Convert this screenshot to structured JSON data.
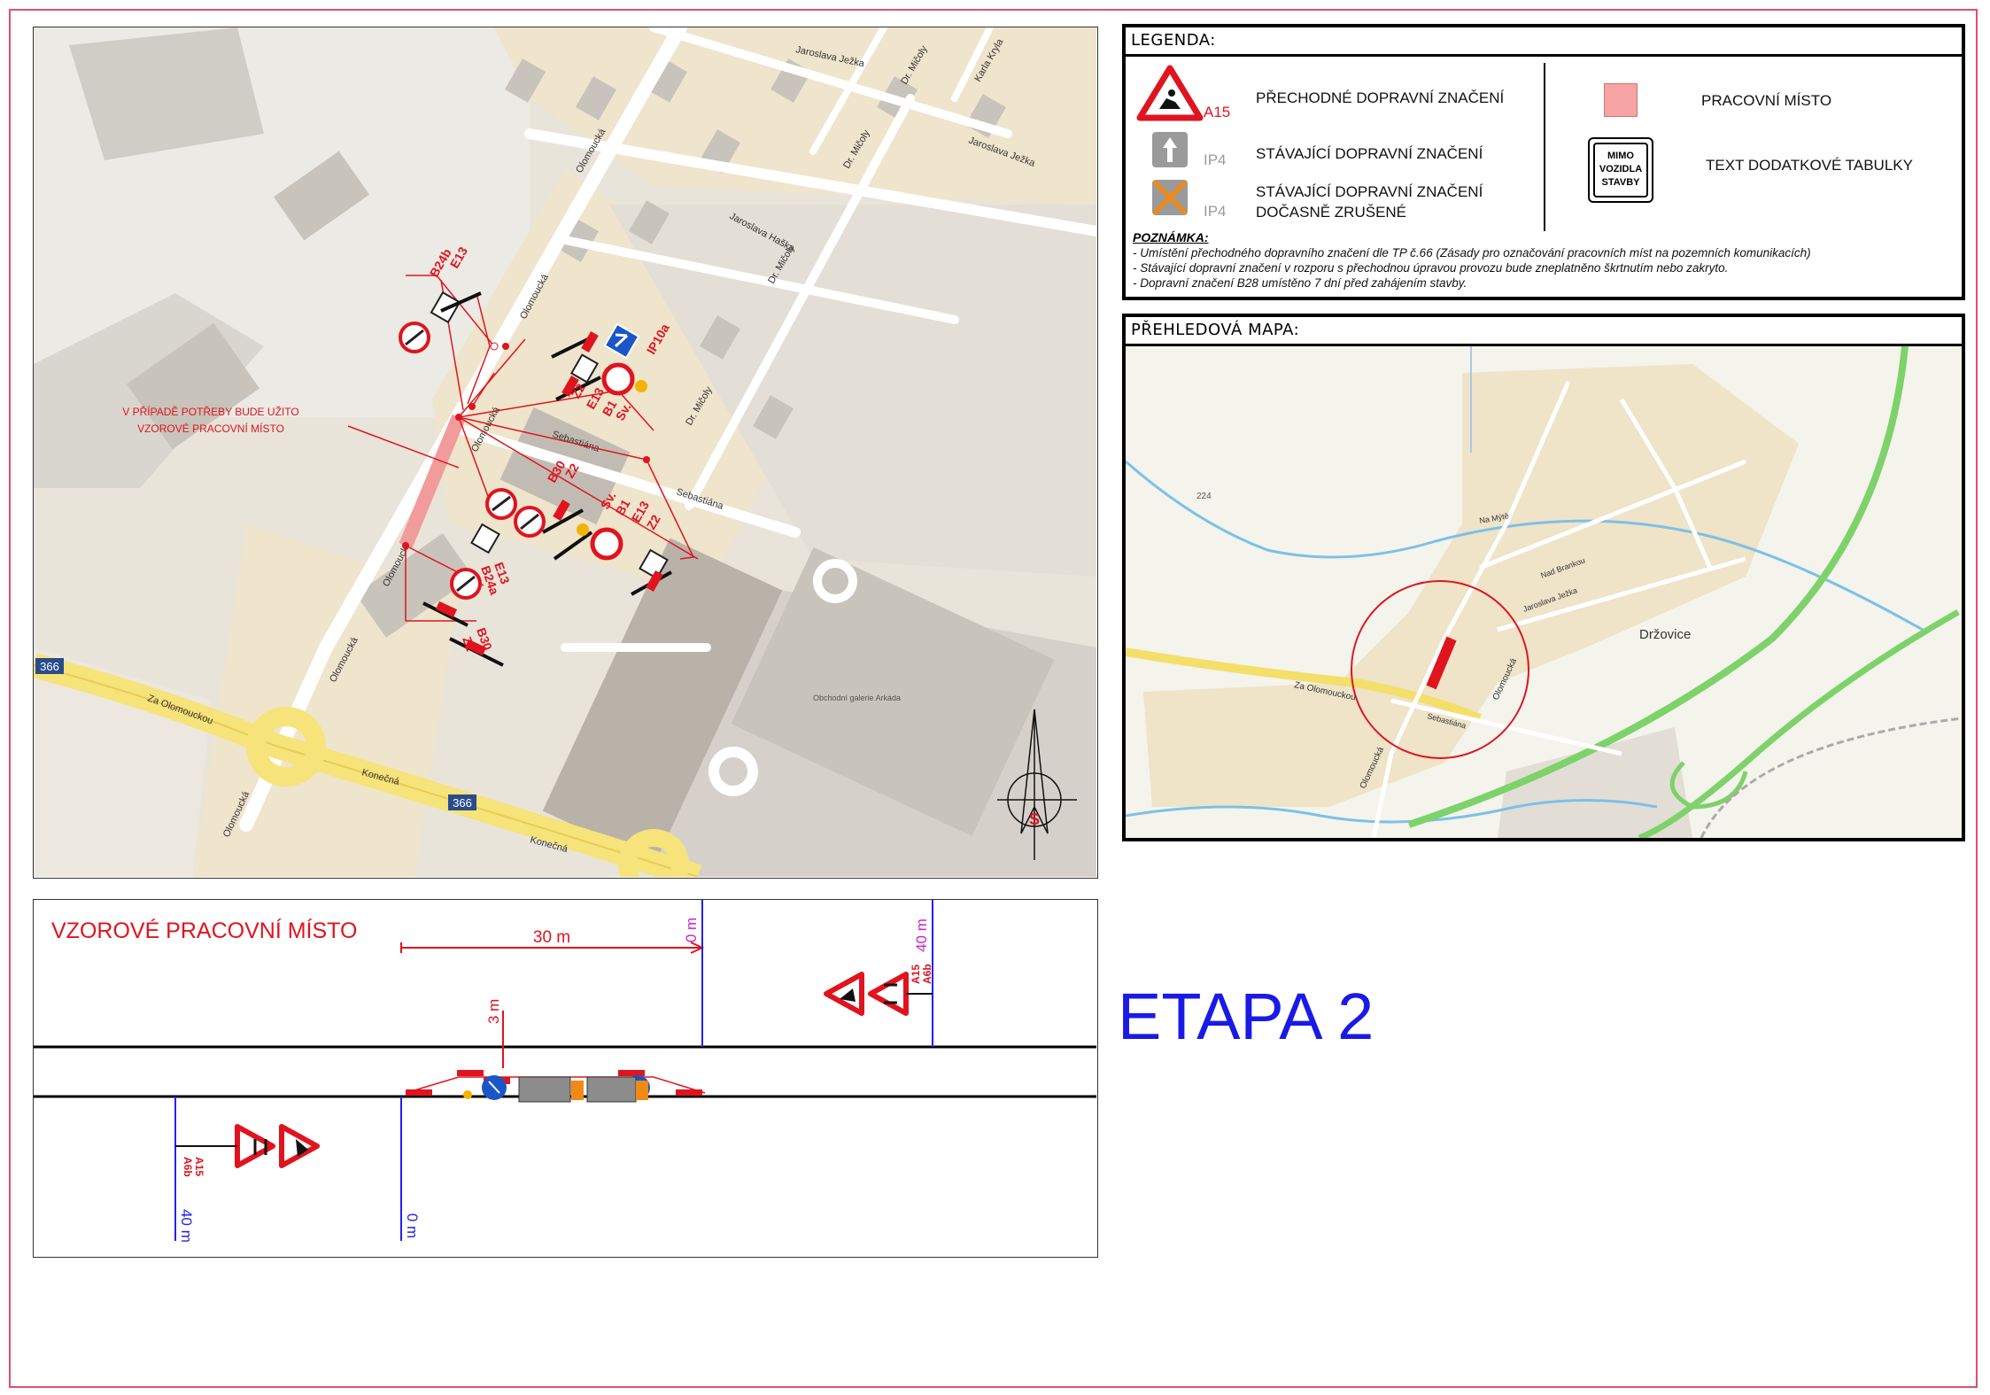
{
  "legend": {
    "title": "LEGENDA:",
    "items": [
      {
        "code": "A15",
        "label": "PŘECHODNÉ DOPRAVNÍ ZNAČENÍ"
      },
      {
        "code": "IP4",
        "label": "STÁVAJÍCÍ DOPRAVNÍ ZNAČENÍ"
      },
      {
        "code": "IP4",
        "label_line1": "STÁVAJÍCÍ DOPRAVNÍ ZNAČENÍ",
        "label_line2": "DOČASNĚ ZRUŠENÉ"
      }
    ],
    "right_items": [
      {
        "label": "PRACOVNÍ MÍSTO",
        "color": "#f5a3a3"
      },
      {
        "sign_line1": "MIMO",
        "sign_line2": "VOZIDLA",
        "sign_line3": "STAVBY",
        "label": "TEXT DODATKOVÉ TABULKY"
      }
    ],
    "note_title": "POZNÁMKA:",
    "notes": [
      "- Umístění přechodného dopravního značení dle TP č.66 (Zásady pro označování pracovních míst na pozemních komunikacích)",
      "- Stávající dopravní značení v rozporu s přechodnou úpravou provozu bude zneplatněno škrtnutím nebo zakryto.",
      "- Dopravní značení B28 umístěno 7 dní před zahájením stavby."
    ]
  },
  "overview": {
    "title": "PŘEHLEDOVÁ MAPA:",
    "labels": {
      "village": "Držovice",
      "street_main": "Za Olomouckou",
      "spot_height": "224",
      "street_1": "Olomoucká",
      "street_2": "Sebastiána",
      "street_3": "Jaroslava Ježka",
      "street_4": "Na Mýtě",
      "street_5": "Nad Brankou"
    }
  },
  "main_map": {
    "streets": {
      "olomoucka": "Olomoucká",
      "za_olomouckou": "Za Olomouckou",
      "jaroslava_jezka": "Jaroslava Ježka",
      "jaroslava_haska": "Jaroslava Haška",
      "dr_micoly": "Dr. Mičoly",
      "sebastiana": "Sebastiána",
      "konecna": "Konečná",
      "karla_kryla": "Karla Kryla"
    },
    "road_number": "366",
    "annotation_line1": "V PŘÍPADĚ POTŘEBY BUDE UŽITO",
    "annotation_line2": "VZOROVÉ PRACOVNÍ MÍSTO",
    "sign_codes": {
      "b24b": "B24b",
      "e13": "E13",
      "ip10a": "IP10a",
      "sv": "Sv.",
      "b1": "B1",
      "z2": "Z2",
      "b30": "B30",
      "b24a": "B24a"
    },
    "compass_label": "S",
    "supermarket": "Obchodní galerie Arkáda"
  },
  "sample": {
    "title": "VZOROVÉ PRACOVNÍ MÍSTO",
    "dim_30": "30 m",
    "dim_3": "3 m",
    "dim_0_top": "0 m",
    "dim_40_top": "40 m",
    "dim_0_bottom": "0 m",
    "dim_40_bottom": "40 m",
    "sign_a15": "A15",
    "sign_a6b": "A6b"
  },
  "etapa": "ETAPA 2"
}
